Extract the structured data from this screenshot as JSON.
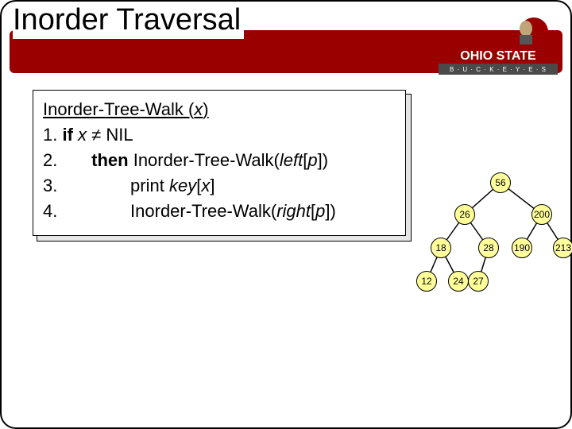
{
  "slide": {
    "title": "Inorder Traversal",
    "logo": {
      "top_text": "OHIO STATE",
      "bottom_text": "B · U · C · K · E · Y · E · S"
    }
  },
  "code": {
    "heading_prefix": "Inorder-Tree-Walk (",
    "heading_var": "x",
    "heading_suffix": ")",
    "line1_prefix": "1.  ",
    "line1_if": "if ",
    "line1_var": "x",
    "line1_rest": " ≠ NIL",
    "line2_prefix": "2.       ",
    "line2_then": "then",
    "line2_call": " Inorder-Tree-Walk(",
    "line2_arg1": "left",
    "line2_mid": "[",
    "line2_arg2": "p",
    "line2_end": "])",
    "line3_prefix": "3.               print ",
    "line3_key": "key",
    "line3_mid": "[",
    "line3_var": "x",
    "line3_end": "]",
    "line4_prefix": "4.               Inorder-Tree-Walk(",
    "line4_arg1": "right",
    "line4_mid": "[",
    "line4_arg2": "p",
    "line4_end": "])"
  },
  "tree": {
    "nodes": {
      "n56": "56",
      "n26": "26",
      "n200": "200",
      "n18": "18",
      "n28": "28",
      "n190": "190",
      "n213": "213",
      "n12": "12",
      "n24": "24",
      "n27": "27"
    }
  }
}
